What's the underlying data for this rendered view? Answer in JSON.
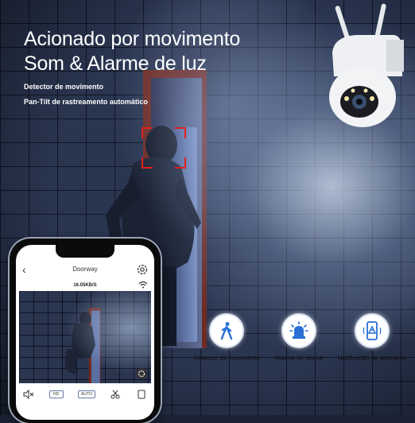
{
  "headline": {
    "line1": "Acionado por movimento",
    "line2": "Som & Alarme de luz"
  },
  "subtitles": [
    "Detector de movimento",
    "Pan-Tilt de rastreamento automático"
  ],
  "phone": {
    "app_title": "Doorway",
    "bitrate": "16.05KB/S",
    "controls": [
      "HD",
      "AUTO"
    ]
  },
  "features": [
    {
      "icon": "walking-person-icon",
      "label": "Detector de movimento"
    },
    {
      "icon": "siren-icon",
      "label": "Alarme de sirene"
    },
    {
      "icon": "phone-notification-icon",
      "label": "Notificação de aplicativo"
    }
  ],
  "colors": {
    "detection_box": "#e02020",
    "feature_icon": "#2a6fd6"
  }
}
